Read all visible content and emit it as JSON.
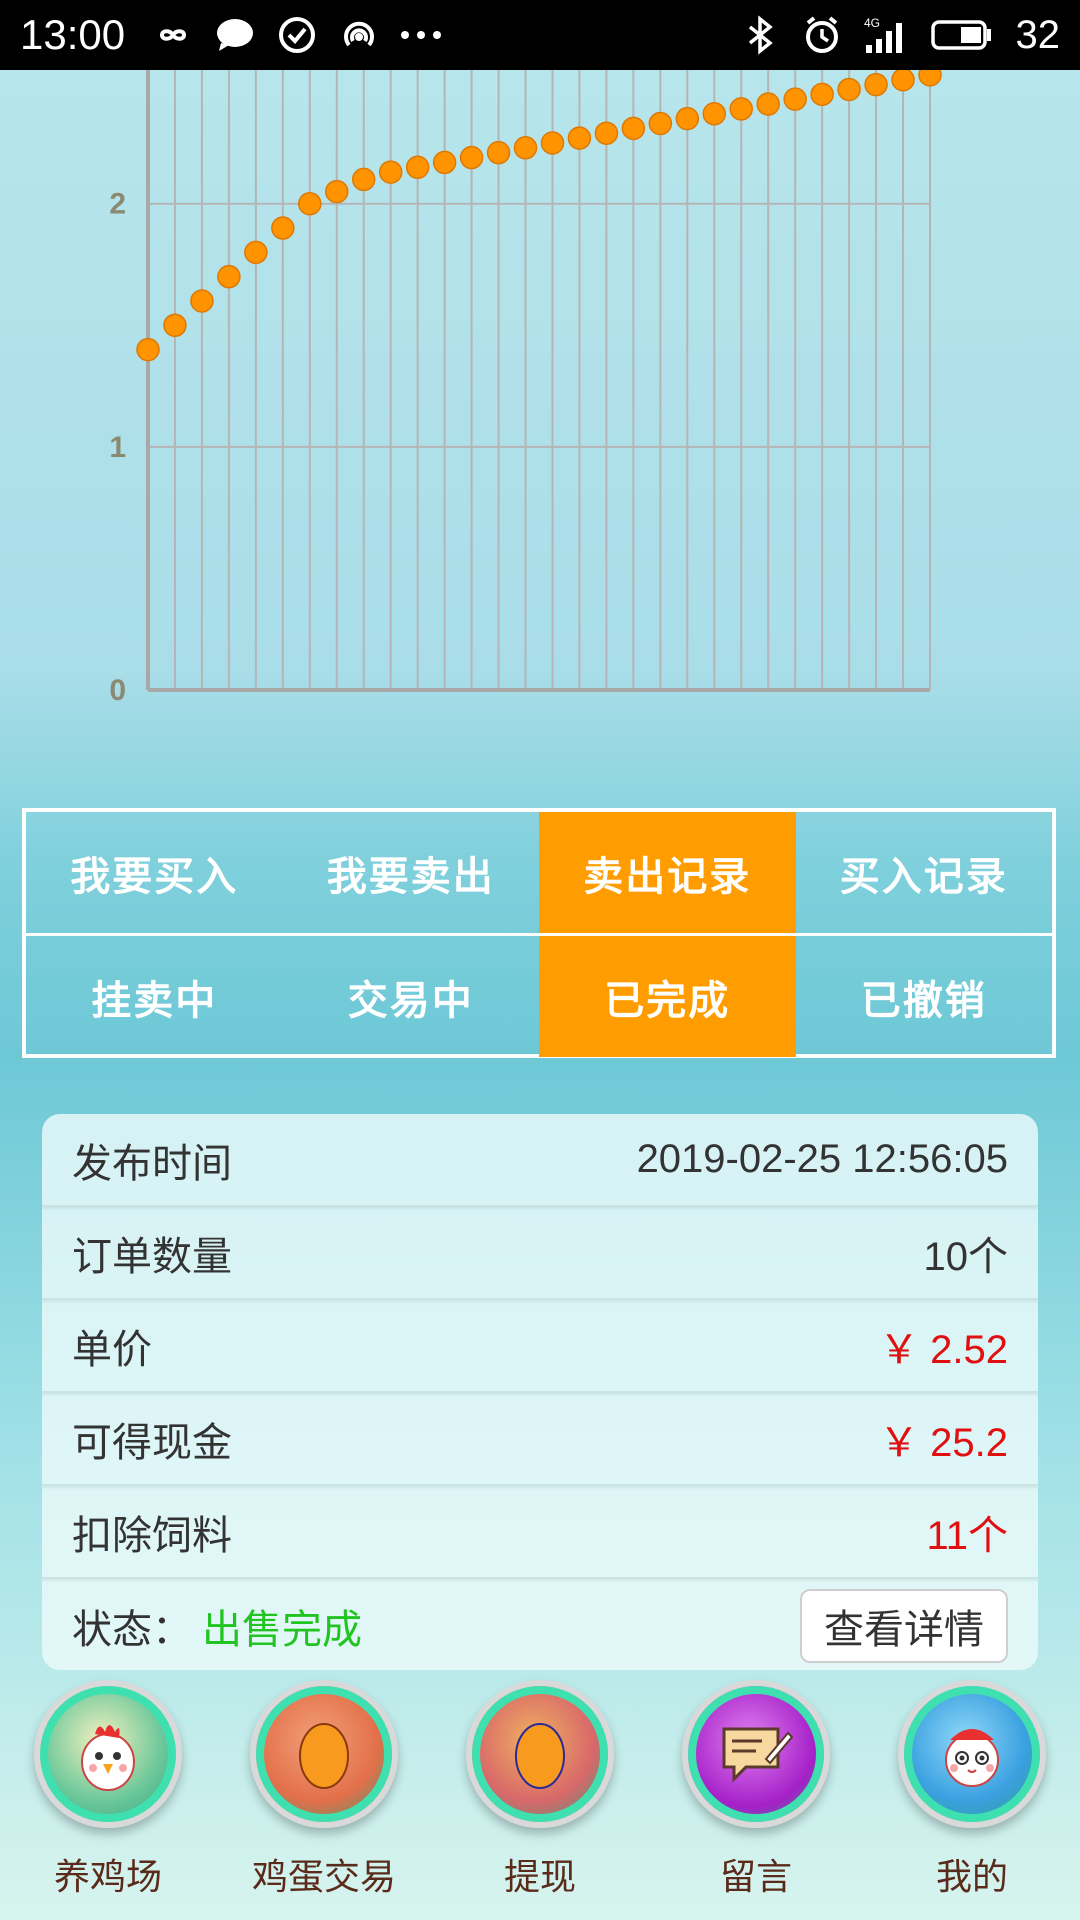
{
  "status_bar": {
    "time": "13:00",
    "left_icons": [
      "infinity-icon",
      "chat-bubble-icon",
      "check-circle-icon",
      "hotspot-icon",
      "more-dots-icon"
    ],
    "right_icons": [
      "bluetooth-icon",
      "alarm-icon",
      "signal-4g-icon",
      "battery-icon"
    ],
    "network_label": "4G",
    "battery": "32"
  },
  "chart_data": {
    "type": "scatter",
    "y_ticks": [
      "0",
      "1",
      "2"
    ],
    "ylim": [
      0,
      2.55
    ],
    "grid": true,
    "marker_color": "#ff9400",
    "values": [
      1.4,
      1.5,
      1.6,
      1.7,
      1.8,
      1.9,
      2.0,
      2.05,
      2.1,
      2.13,
      2.15,
      2.17,
      2.19,
      2.21,
      2.23,
      2.25,
      2.27,
      2.29,
      2.31,
      2.33,
      2.35,
      2.37,
      2.39,
      2.41,
      2.43,
      2.45,
      2.47,
      2.49,
      2.51,
      2.53
    ]
  },
  "tabs": {
    "row1": [
      {
        "label": "我要买入",
        "active": false
      },
      {
        "label": "我要卖出",
        "active": false
      },
      {
        "label": "卖出记录",
        "active": true
      },
      {
        "label": "买入记录",
        "active": false
      }
    ],
    "row2": [
      {
        "label": "挂卖中",
        "active": false
      },
      {
        "label": "交易中",
        "active": false
      },
      {
        "label": "已完成",
        "active": true
      },
      {
        "label": "已撤销",
        "active": false
      }
    ]
  },
  "record": {
    "publish_time_label": "发布时间",
    "publish_time_value": "2019-02-25 12:56:05",
    "order_qty_label": "订单数量",
    "order_qty_value": "10个",
    "unit_price_label": "单价",
    "unit_price_value": "￥ 2.52",
    "cash_label": "可得现金",
    "cash_value": "￥ 25.2",
    "feed_label": "扣除饲料",
    "feed_value": "11个",
    "status_label": "状态：",
    "status_value": "出售完成",
    "detail_button": "查看详情"
  },
  "bottom_nav": [
    {
      "label": "养鸡场",
      "icon": "chicken-icon"
    },
    {
      "label": "鸡蛋交易",
      "icon": "egg-trade-icon"
    },
    {
      "label": "提现",
      "icon": "egg-withdraw-icon"
    },
    {
      "label": "留言",
      "icon": "message-note-icon"
    },
    {
      "label": "我的",
      "icon": "profile-avatar-icon"
    }
  ],
  "colors": {
    "accent": "#ff9c00",
    "price_red": "#e01010",
    "status_green": "#22c422"
  }
}
